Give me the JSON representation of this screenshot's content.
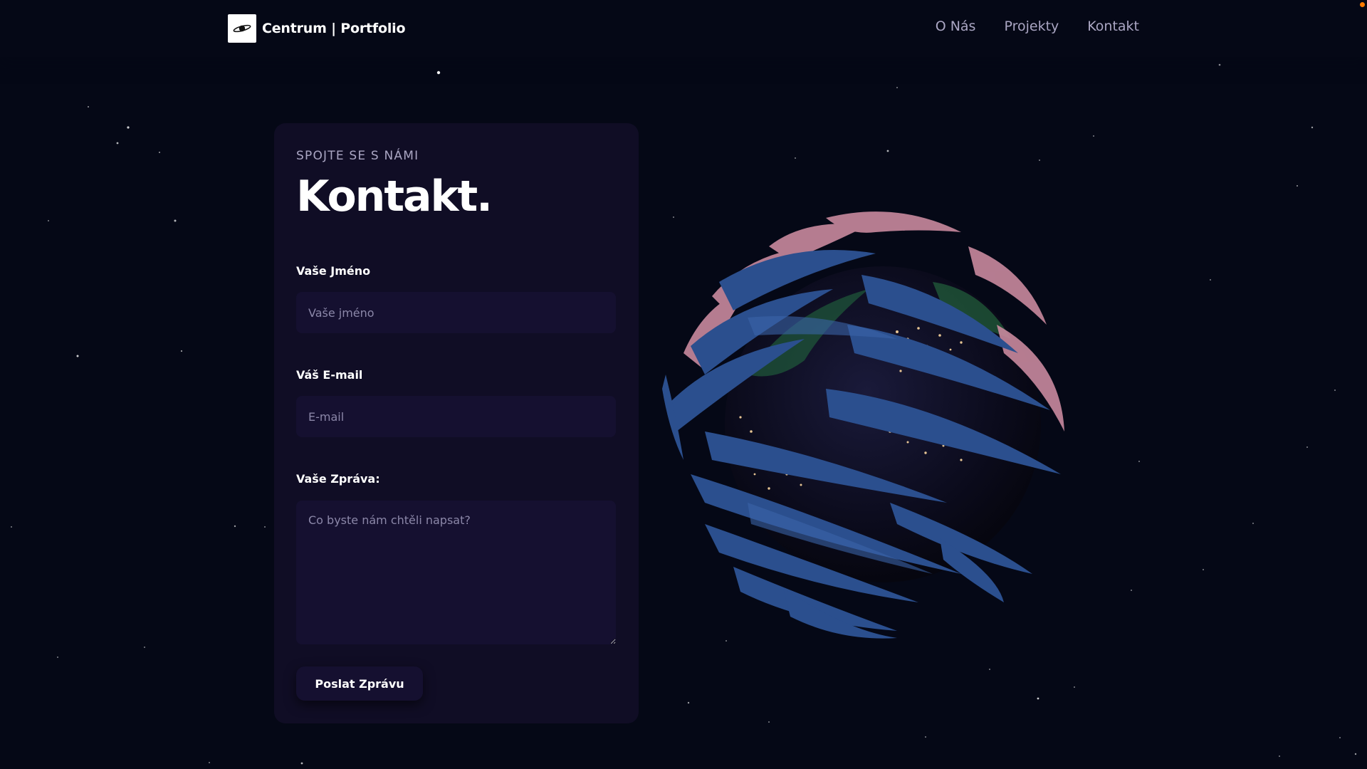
{
  "nav": {
    "brand": "Centrum | Portfolio",
    "logo_icon": "saturn-logo-icon",
    "links": [
      {
        "label": "O Nás"
      },
      {
        "label": "Projekty"
      },
      {
        "label": "Kontakt"
      }
    ]
  },
  "contact": {
    "subtitle": "Spojte se s námi",
    "title": "Kontakt.",
    "name_label": "Vaše Jméno",
    "name_placeholder": "Vaše jméno",
    "name_value": "",
    "email_label": "Váš E-mail",
    "email_placeholder": "E-mail",
    "email_value": "",
    "message_label": "Vaše Zpráva:",
    "message_placeholder": "Co byste nám chtěli napsat?",
    "message_value": "",
    "submit_label": "Poslat Zprávu"
  },
  "colors": {
    "background": "#050816",
    "card": "#100d25",
    "input": "#151030",
    "secondary_text": "#aaa6c3",
    "accent_dot": "#ff7a00",
    "globe_swirl_blue": "#2b4f8e",
    "globe_swirl_pink": "#c9899e"
  },
  "visual": {
    "globe_icon": "3d-earth-globe-icon"
  }
}
